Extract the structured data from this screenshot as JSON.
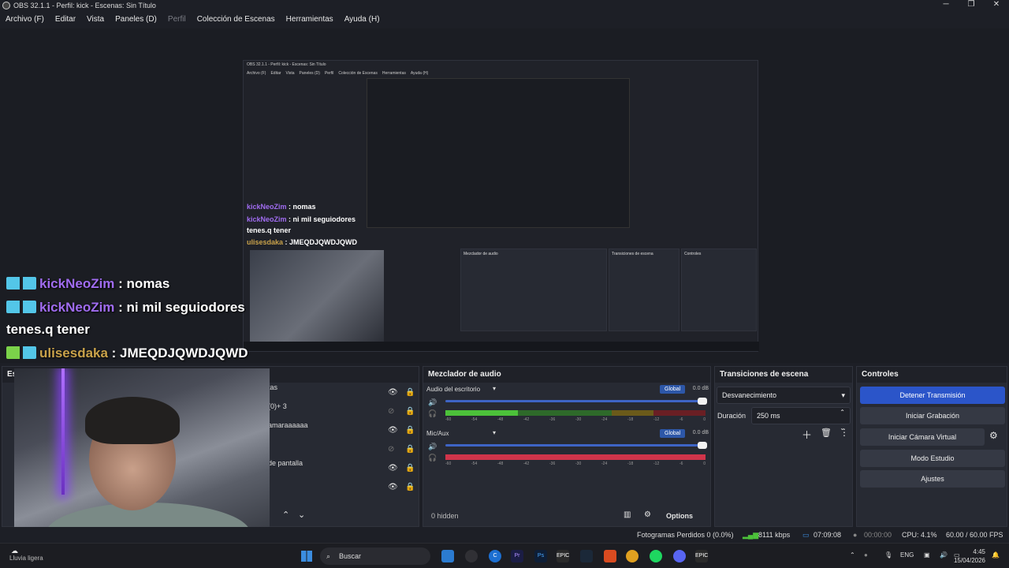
{
  "window": {
    "title": "OBS 32.1.1 - Perfil: kick - Escenas: Sin Título"
  },
  "menu": [
    {
      "label": "Archivo (F)",
      "enabled": true
    },
    {
      "label": "Editar",
      "enabled": true
    },
    {
      "label": "Vista",
      "enabled": true
    },
    {
      "label": "Paneles (D)",
      "enabled": true
    },
    {
      "label": "Perfil",
      "enabled": false
    },
    {
      "label": "Colección de Escenas",
      "enabled": true
    },
    {
      "label": "Herramientas",
      "enabled": true
    },
    {
      "label": "Ayuda (H)",
      "enabled": true
    }
  ],
  "chat": [
    {
      "user": "kickNeoZim",
      "message": " : nomas",
      "badge": "blue"
    },
    {
      "user": "kickNeoZim",
      "message": " : ni mil seguiodores",
      "badge": "blue"
    },
    {
      "user": "",
      "message": "tenes.q tener",
      "badge": ""
    },
    {
      "user": "ulisesdaka",
      "message": " : JMEQDJQWDJQWD",
      "badge": "green"
    }
  ],
  "sources_partial": [
    "tas",
    "(0)+ 3",
    "amaraaaaaa",
    "",
    "de pantalla",
    ""
  ],
  "mixer": {
    "title": "Mezclador de audio",
    "channels": [
      {
        "name": "Audio del escritorio",
        "global": "Global",
        "db": "0.0 dB",
        "level": 0.28
      },
      {
        "name": "Mic/Aux",
        "global": "Global",
        "db": "0.0 dB",
        "level": 0.0
      }
    ],
    "ticks": [
      "-60",
      "-54",
      "-48",
      "-42",
      "-36",
      "-30",
      "-24",
      "-18",
      "-12",
      "-6",
      "0"
    ],
    "hidden": "0 hidden",
    "options": "Options"
  },
  "transitions": {
    "title": "Transiciones de escena",
    "selected": "Desvanecimiento",
    "duration_label": "Duración",
    "duration_value": "250 ms"
  },
  "controls": {
    "title": "Controles",
    "buttons": [
      "Detener Transmisión",
      "Iniciar Grabación",
      "Iniciar Cámara Virtual",
      "Modo Estudio",
      "Ajustes"
    ]
  },
  "scenes_title": "Esc",
  "status": {
    "dropped": "Fotogramas Perdidos 0 (0.0%)",
    "bitrate": "8111 kbps",
    "stream_time": "07:09:08",
    "rec_time": "00:00:00",
    "cpu": "CPU: 4.1%",
    "fps": "60.00 / 60.00 FPS"
  },
  "taskbar": {
    "weather": "Lluvia ligera",
    "search": "Buscar",
    "lang": "ENG",
    "time": "4:45",
    "date": "15/04/2026"
  },
  "nested_chat": [
    {
      "user": "kickNeoZim",
      "message": " : nomas"
    },
    {
      "user": "kickNeoZim",
      "message": " : ni mil seguiodores"
    },
    {
      "user": "",
      "message": "tenes.q tener"
    },
    {
      "user": "ulisesdaka",
      "message": " : JMEQDJQWDJQWD"
    }
  ]
}
